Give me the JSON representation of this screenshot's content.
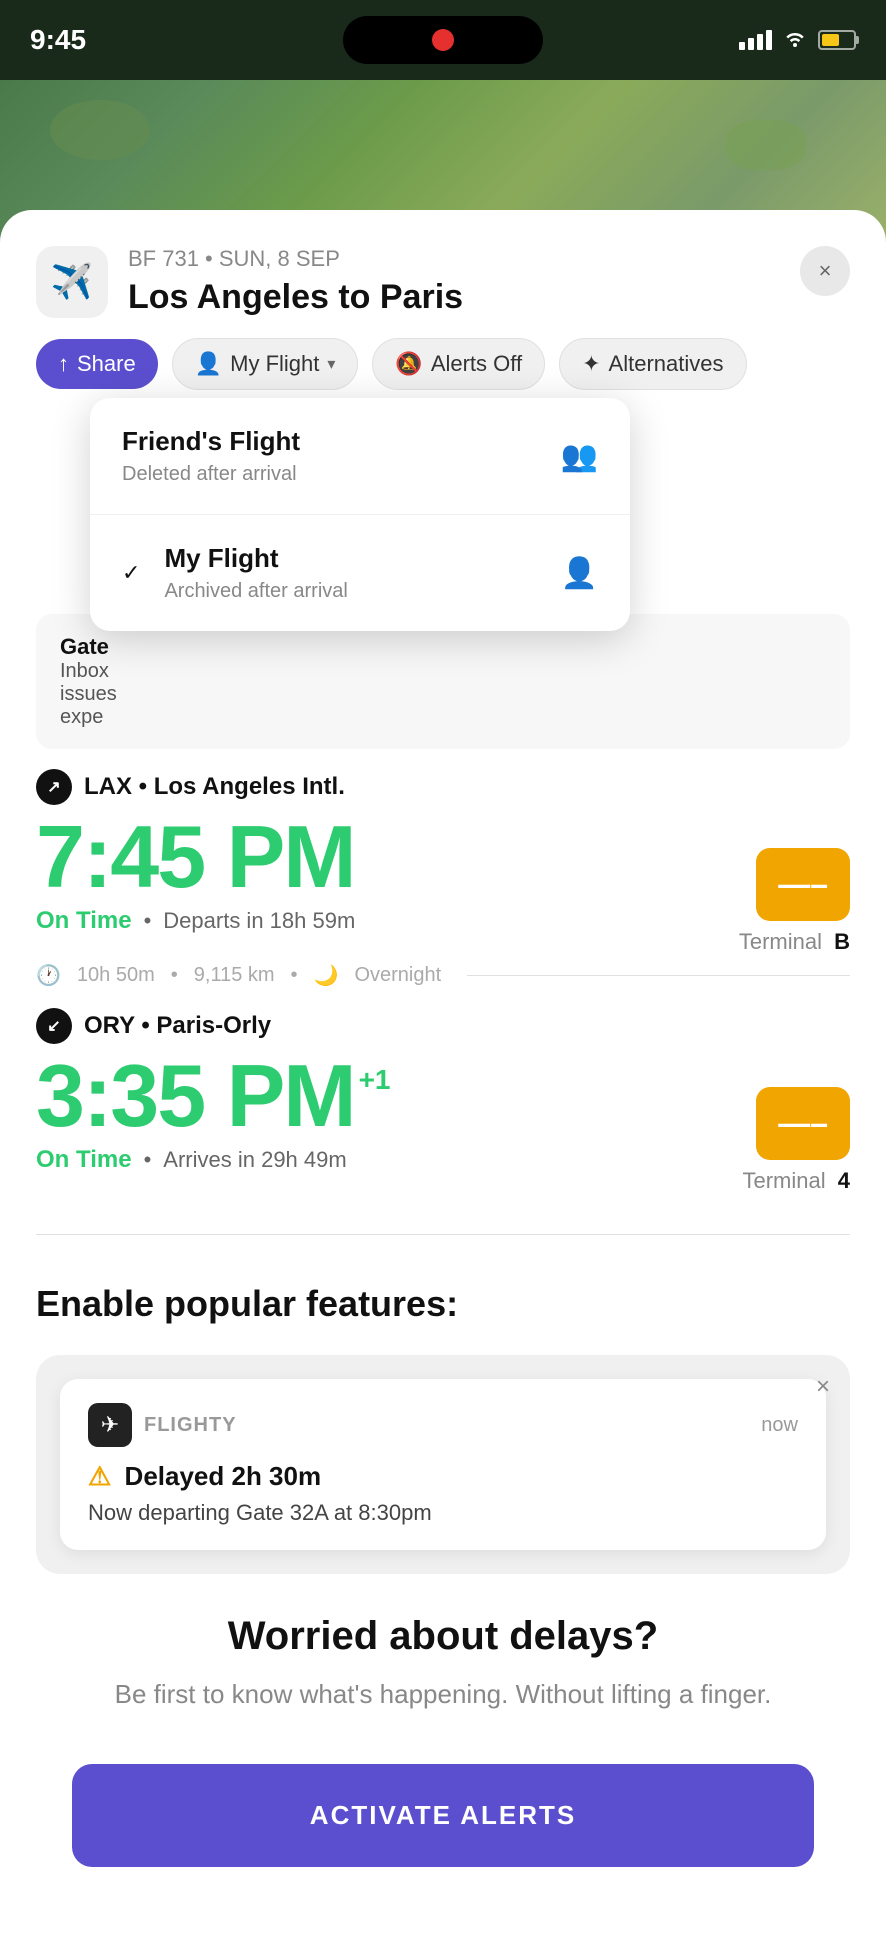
{
  "statusBar": {
    "time": "9:45",
    "signal": "signal",
    "wifi": "wifi",
    "battery": "battery"
  },
  "header": {
    "flightCode": "BF 731 • SUN, 8 SEP",
    "route": "Los Angeles to Paris",
    "closeLabel": "×"
  },
  "actions": {
    "shareLabel": "Share",
    "myFlightLabel": "My Flight",
    "alertsLabel": "Alerts Off",
    "alternativesLabel": "Alternatives"
  },
  "dropdown": {
    "friendsFlight": {
      "title": "Friend's Flight",
      "subtitle": "Deleted after arrival"
    },
    "myFlight": {
      "title": "My Flight",
      "subtitle": "Archived after arrival",
      "checked": true
    }
  },
  "gate": {
    "label": "Gat",
    "inboxLine": "Inbo",
    "issues": "sues",
    "extra": "expe"
  },
  "departure": {
    "airport": "LAX • Los Angeles Intl.",
    "direction": "↗",
    "time": "7:45 PM",
    "status": "On Time",
    "statusDetail": "Departs in 18h 59m",
    "terminal": "B",
    "terminalLabel": "Terminal"
  },
  "flightInfo": {
    "duration": "10h 50m",
    "distance": "9,115 km",
    "overnight": "Overnight"
  },
  "arrival": {
    "airport": "ORY • Paris-Orly",
    "direction": "↙",
    "time": "3:35 PM",
    "dayPlus": "+1",
    "status": "On Time",
    "statusDetail": "Arrives in 29h 49m",
    "terminal": "4",
    "terminalLabel": "Terminal"
  },
  "features": {
    "sectionTitle": "Enable popular features:",
    "notification": {
      "appName": "FLIGHTY",
      "time": "now",
      "title": "⚠ Delayed 2h 30m",
      "body": "Now departing Gate 32A at 8:30pm"
    },
    "promoteTitle": "Worried about delays?",
    "promoteSub": "Be first to know what's happening. Without lifting a finger.",
    "activateLabel": "ACTIVATE ALERTS"
  },
  "icons": {
    "plane": "✈",
    "mute": "🔕",
    "alternatives": "✦",
    "person": "👤",
    "people": "👥",
    "check": "✓",
    "clock": "🕐",
    "moon": "🌙",
    "warning": "⚠️"
  },
  "colors": {
    "green": "#2ecc71",
    "purple": "#5b4fcf",
    "orange": "#f0a500",
    "darkBg": "#1a2a1a"
  }
}
